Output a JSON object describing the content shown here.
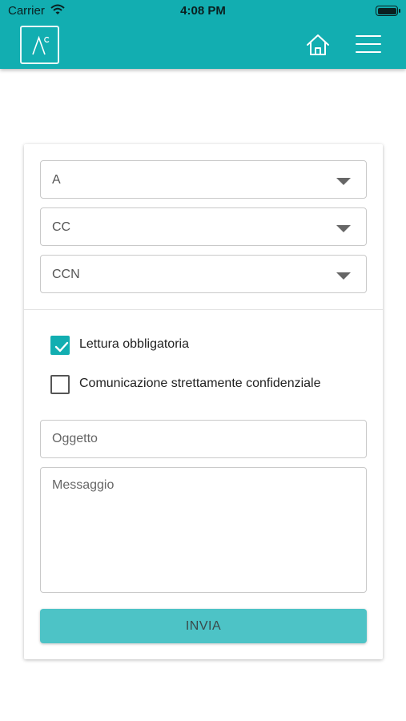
{
  "status_bar": {
    "carrier": "Carrier",
    "time": "4:08 PM"
  },
  "header": {
    "logo_icon": "logo-mark-icon",
    "home_icon": "home-icon",
    "menu_icon": "hamburger-menu-icon",
    "background_color": "#12aeb1"
  },
  "form": {
    "recipients": [
      {
        "label": "A"
      },
      {
        "label": "CC"
      },
      {
        "label": "CCN"
      }
    ],
    "options": [
      {
        "label": "Lettura obbligatoria",
        "checked": true
      },
      {
        "label": "Comunicazione strettamente confidenziale",
        "checked": false
      }
    ],
    "subject_placeholder": "Oggetto",
    "message_placeholder": "Messaggio",
    "send_label": "INVIA",
    "accent_color": "#12aeb1",
    "button_color": "#4dc3c6"
  }
}
